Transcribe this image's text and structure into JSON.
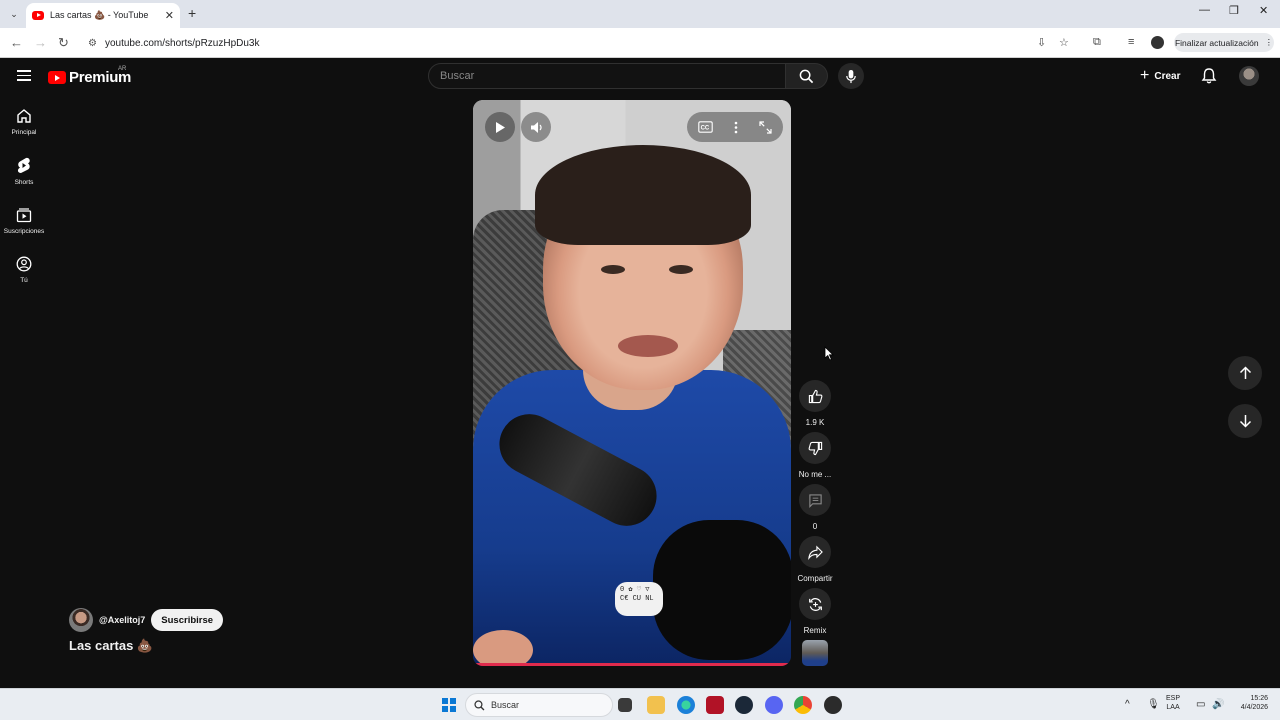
{
  "browser": {
    "tab_title": "Las cartas 💩 - YouTube",
    "url": "youtube.com/shorts/pRzuzHpDu3k",
    "update_button": "Finalizar actualización"
  },
  "yt": {
    "logo_text": "Premium",
    "country_code": "AR",
    "search_placeholder": "Buscar",
    "create_label": "Crear"
  },
  "sidebar": {
    "items": [
      {
        "label": "Principal",
        "icon": "home-icon"
      },
      {
        "label": "Shorts",
        "icon": "shorts-icon"
      },
      {
        "label": "Suscripciones",
        "icon": "subscriptions-icon"
      },
      {
        "label": "Tú",
        "icon": "you-icon"
      }
    ]
  },
  "video": {
    "sticker_text": "0 ✿ ♡ ▽\nC€ CU NL"
  },
  "actions": {
    "likes": "1.9 K",
    "dislike": "No me ...",
    "comments": "0",
    "share": "Compartir",
    "remix": "Remix"
  },
  "channel": {
    "handle": "@Axelitoj7",
    "subscribe": "Suscribirse",
    "title": "Las cartas 💩"
  },
  "taskbar": {
    "search": "Buscar",
    "lang_top": "ESP",
    "lang_bottom": "LAA",
    "time": "15:26",
    "date": "4/4/2026"
  }
}
